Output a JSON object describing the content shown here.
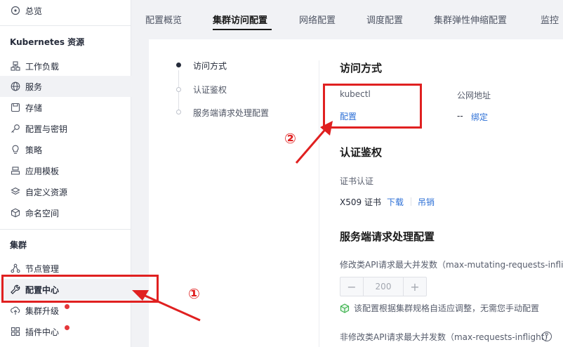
{
  "sidebar": {
    "overview": "总览",
    "k8s_section": "Kubernetes 资源",
    "items": [
      {
        "label": "工作负载",
        "icon": "workload-icon"
      },
      {
        "label": "服务",
        "icon": "globe-icon"
      },
      {
        "label": "存储",
        "icon": "storage-icon"
      },
      {
        "label": "配置与密钥",
        "icon": "key-icon"
      },
      {
        "label": "策略",
        "icon": "bulb-icon"
      },
      {
        "label": "应用模板",
        "icon": "template-icon"
      },
      {
        "label": "自定义资源",
        "icon": "layers-icon"
      },
      {
        "label": "命名空间",
        "icon": "cube-icon"
      }
    ],
    "cluster_section": "集群",
    "cluster_items": [
      {
        "label": "节点管理",
        "icon": "nodes-icon"
      },
      {
        "label": "配置中心",
        "icon": "wrench-icon"
      },
      {
        "label": "集群升级",
        "icon": "upgrade-icon"
      },
      {
        "label": "插件中心",
        "icon": "grid-icon"
      }
    ]
  },
  "tabs": [
    "配置概览",
    "集群访问配置",
    "网络配置",
    "调度配置",
    "集群弹性伸缩配置",
    "监控"
  ],
  "anchors": [
    "访问方式",
    "认证鉴权",
    "服务端请求处理配置"
  ],
  "access": {
    "title": "访问方式",
    "kubectl_label": "kubectl",
    "kubectl_link": "配置",
    "public_label": "公网地址",
    "public_value": "--",
    "public_link": "绑定"
  },
  "auth": {
    "title": "认证鉴权",
    "cert_label": "证书认证",
    "cert_value": "X509 证书",
    "download": "下载",
    "revoke": "吊销"
  },
  "server": {
    "title": "服务端请求处理配置",
    "mutating_label": "修改类API请求最大并发数（max-mutating-requests-inflight)",
    "stepper_value": "200",
    "hint": "该配置根据集群规格自适应调整，无需您手动配置",
    "nonmutating_label": "非修改类API请求最大并发数（max-requests-inflight)",
    "help": "?"
  },
  "annotations": {
    "step1": "①",
    "step2": "②"
  },
  "colors": {
    "accent": "#2c6fd6",
    "annotation": "#e02020",
    "hint_icon": "#3eb34f"
  }
}
